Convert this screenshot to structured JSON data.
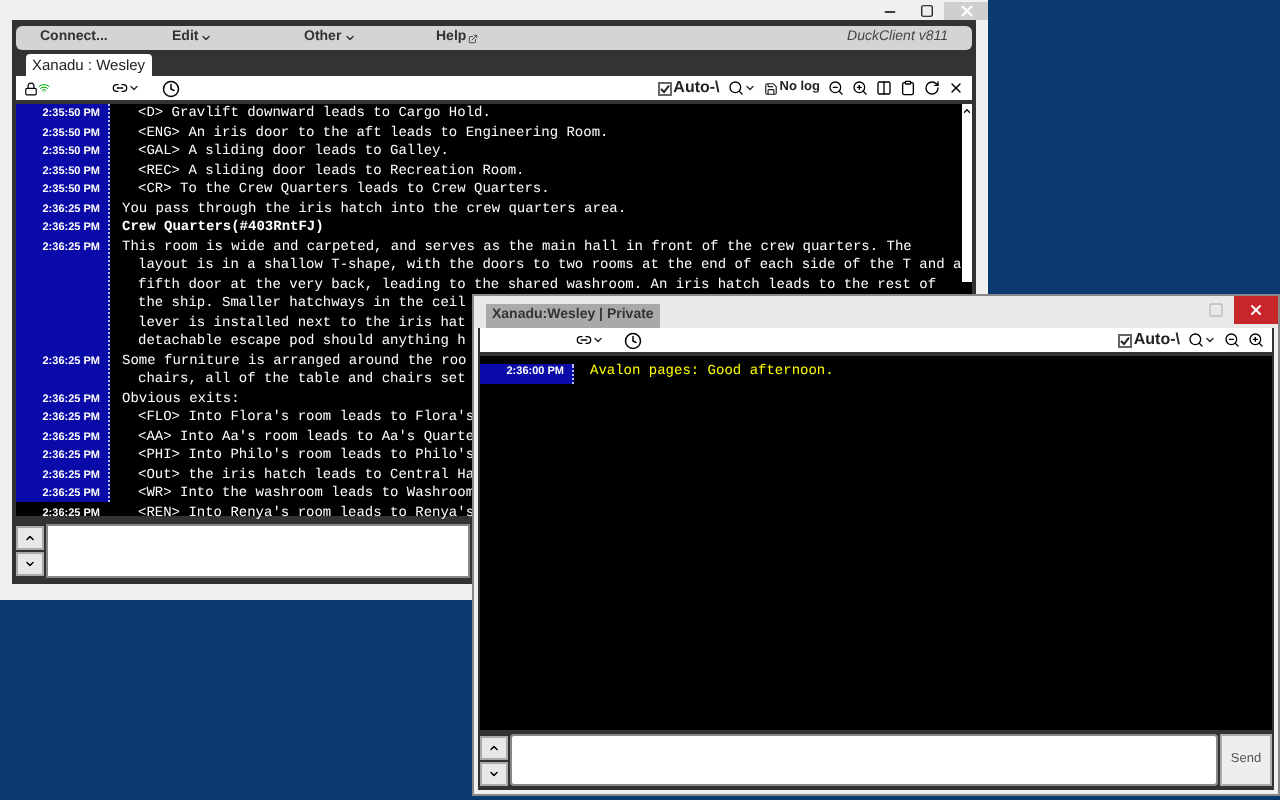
{
  "main_window": {
    "menu": [
      {
        "label": "Connect...",
        "kind": "plain"
      },
      {
        "label": "Edit",
        "kind": "dropdown"
      },
      {
        "label": "Other",
        "kind": "dropdown"
      },
      {
        "label": "Help",
        "kind": "external"
      }
    ],
    "version": "DuckClient v811",
    "tab": "Xanadu : Wesley",
    "toolbar": {
      "auto_label": "Auto-\\",
      "auto_checked": true,
      "log_label": "No log"
    },
    "log": [
      {
        "time": "2:35:50 PM",
        "indented": true,
        "bold": false,
        "lines": [
          "<D> Gravlift downward leads to Cargo Hold."
        ]
      },
      {
        "time": "2:35:50 PM",
        "indented": true,
        "bold": false,
        "lines": [
          "<ENG> An iris door to the aft leads to Engineering Room."
        ]
      },
      {
        "time": "2:35:50 PM",
        "indented": true,
        "bold": false,
        "lines": [
          "<GAL> A sliding door leads to Galley."
        ]
      },
      {
        "time": "2:35:50 PM",
        "indented": true,
        "bold": false,
        "lines": [
          "<REC> A sliding door leads to Recreation Room."
        ]
      },
      {
        "time": "2:35:50 PM",
        "indented": true,
        "bold": false,
        "lines": [
          "<CR> To the Crew Quarters leads to Crew Quarters."
        ]
      },
      {
        "time": "2:36:25 PM",
        "indented": false,
        "bold": false,
        "lines": [
          "You pass through the iris hatch into the crew quarters area."
        ]
      },
      {
        "time": "2:36:25 PM",
        "indented": false,
        "bold": true,
        "lines": [
          "Crew Quarters(#403RntFJ)"
        ]
      },
      {
        "time": "2:36:25 PM",
        "indented": false,
        "bold": false,
        "lines": [
          "This room is wide and carpeted, and serves as the main hall in front of the crew quarters. The",
          "layout is in a shallow T-shape, with the doors to two rooms at the end of each side of the T and a",
          "fifth door at the very back, leading to the shared washroom. An iris hatch leads to the rest of",
          "the ship. Smaller hatchways in the ceil",
          "lever is installed next to the iris hat",
          "detachable escape pod should anything h"
        ]
      },
      {
        "time": "2:36:25 PM",
        "indented": false,
        "bold": false,
        "lines": [
          "Some furniture is arranged around the roo",
          "chairs, all of the table and chairs set"
        ]
      },
      {
        "time": "2:36:25 PM",
        "indented": false,
        "bold": false,
        "lines": [
          "Obvious exits:"
        ]
      },
      {
        "time": "2:36:25 PM",
        "indented": true,
        "bold": false,
        "lines": [
          "<FLO> Into Flora's room leads to Flora's"
        ]
      },
      {
        "time": "2:36:25 PM",
        "indented": true,
        "bold": false,
        "lines": [
          "<AA> Into Aa's room leads to Aa's Quarte"
        ]
      },
      {
        "time": "2:36:25 PM",
        "indented": true,
        "bold": false,
        "lines": [
          "<PHI> Into Philo's room leads to Philo's"
        ]
      },
      {
        "time": "2:36:25 PM",
        "indented": true,
        "bold": false,
        "lines": [
          "<Out> the iris hatch leads to Central Ha"
        ]
      },
      {
        "time": "2:36:25 PM",
        "indented": true,
        "bold": false,
        "lines": [
          "<WR> Into the washroom leads to Washroom"
        ]
      },
      {
        "time": "2:36:25 PM",
        "indented": true,
        "bold": false,
        "lines": [
          "<REN> Into Renya's room leads to Renya's"
        ]
      }
    ]
  },
  "private_window": {
    "title": "Xanadu:Wesley | Private",
    "toolbar": {
      "auto_label": "Auto-\\",
      "auto_checked": true
    },
    "log": [
      {
        "time": "2:36:00 PM",
        "text": "Avalon pages: Good afternoon.",
        "color": "#ffff00"
      }
    ],
    "send": "Send"
  }
}
